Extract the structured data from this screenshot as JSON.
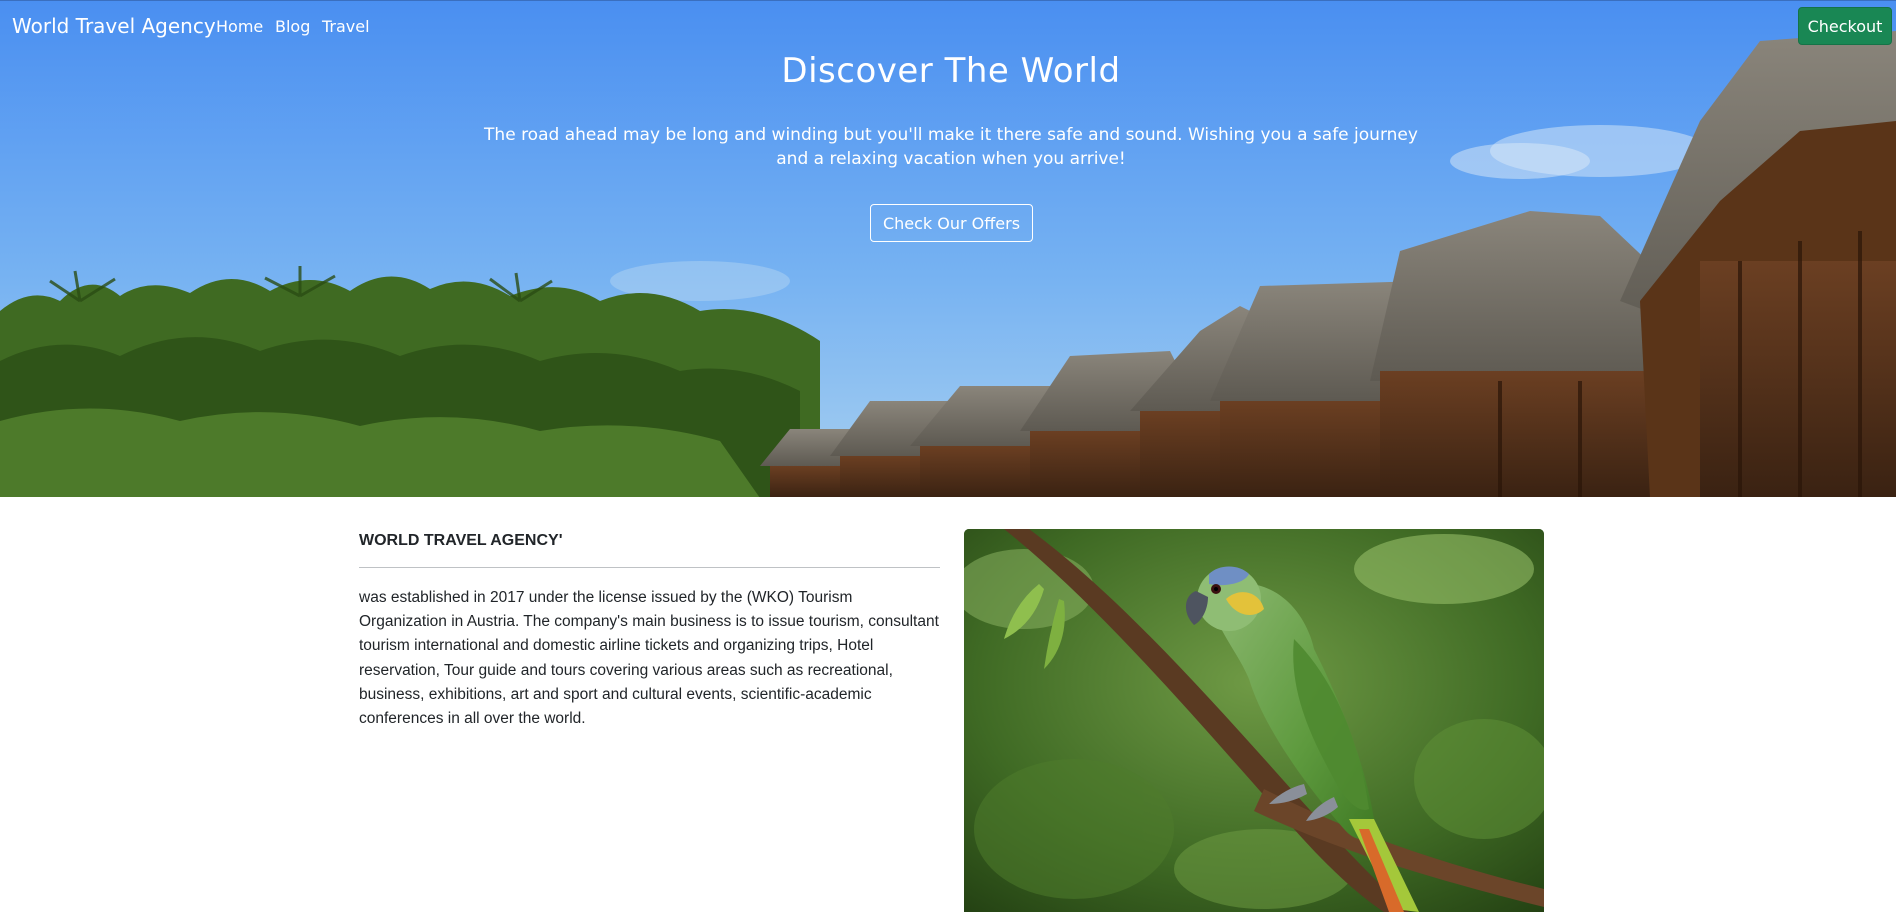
{
  "navbar": {
    "brand": "World Travel Agency",
    "links": [
      "Home",
      "Blog",
      "Travel"
    ],
    "checkout_label": "Checkout"
  },
  "hero": {
    "title": "Discover The World",
    "subtitle": "The road ahead may be long and winding but you'll make it there safe and sound. Wishing you a safe journey and a relaxing vacation when you arrive!",
    "button_label": "Check Our Offers"
  },
  "about": {
    "title": "WORLD TRAVEL AGENCY'",
    "text": "was established in 2017 under the license issued by the (WKO) Tourism Organization in Austria. The company's main business is to issue tourism, consultant tourism international and domestic airline tickets and organizing trips, Hotel reservation, Tour guide and tours covering various areas such as recreational, business, exhibitions, art and sport and cultural events, scientific-academic conferences in all over the world."
  },
  "colors": {
    "checkout": "#198754",
    "sky": "#4e93f2"
  },
  "icons": {
    "hero_background": "tropical-resort-photo",
    "about_image": "green-parrot-photo"
  }
}
